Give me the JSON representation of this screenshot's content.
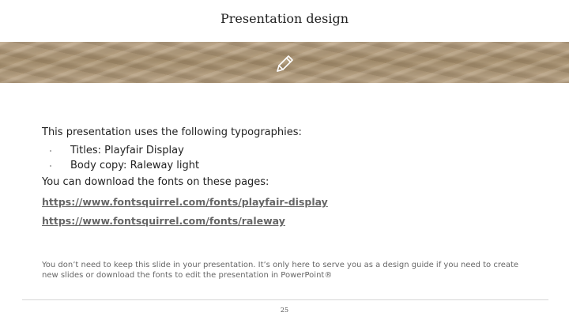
{
  "slide": {
    "title": "Presentation design",
    "intro": "This presentation uses the following typographies:",
    "bullets": [
      "Titles: Playfair Display",
      "Body copy: Raleway light"
    ],
    "download_text": "You can download the fonts on these pages:",
    "links": [
      "https://www.fontsquirrel.com/fonts/playfair-display",
      "https://www.fontsquirrel.com/fonts/raleway"
    ],
    "footnote": "You don’t need to keep this slide in your presentation. It’s only here to serve you as a design guide if you need to create new slides or download the fonts to edit the presentation in PowerPoint®",
    "page_number": "25"
  },
  "icons": {
    "band_icon": "pencil-icon"
  },
  "colors": {
    "text": "#222222",
    "link": "#666666",
    "sand": "#b09a7a"
  }
}
